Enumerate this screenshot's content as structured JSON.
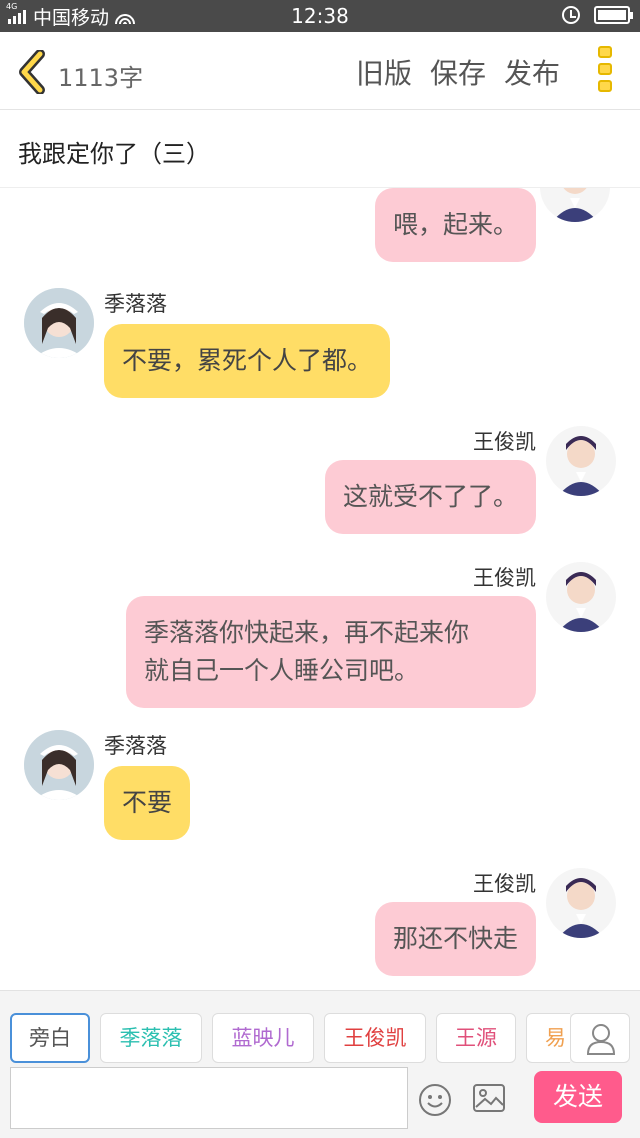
{
  "status_bar": {
    "network": "4G",
    "carrier": "中国移动",
    "time": "12:38"
  },
  "toolbar": {
    "word_count": "1113字",
    "old_version": "旧版",
    "save": "保存",
    "publish": "发布"
  },
  "story": {
    "title": "我跟定你了（三）"
  },
  "messages": [
    {
      "side": "right",
      "speaker": "",
      "text": "喂，起来。",
      "color": "#fdcbd4"
    },
    {
      "side": "left",
      "speaker": "季落落",
      "text": "不要，累死个人了都。",
      "color": "#ffdd66"
    },
    {
      "side": "right",
      "speaker": "王俊凯",
      "text": "这就受不了了。",
      "color": "#fdcbd4"
    },
    {
      "side": "right",
      "speaker": "王俊凯",
      "lines": [
        "季落落你快起来，再不起来你",
        "就自己一个人睡公司吧。"
      ],
      "color": "#fdcbd4"
    },
    {
      "side": "left",
      "speaker": "季落落",
      "text": "不要",
      "color": "#ffdd66"
    },
    {
      "side": "right",
      "speaker": "王俊凯",
      "text": "那还不快走",
      "color": "#fdcbd4"
    }
  ],
  "characters": [
    {
      "name": "旁白",
      "color": "#555555"
    },
    {
      "name": "季落落",
      "color": "#2bbfb0"
    },
    {
      "name": "蓝映儿",
      "color": "#b06ad0"
    },
    {
      "name": "王俊凯",
      "color": "#e04040"
    },
    {
      "name": "王源",
      "color": "#e0507a"
    },
    {
      "name": "易",
      "color": "#f0a050"
    }
  ],
  "composer": {
    "input_value": "",
    "send_label": "发送"
  },
  "icons": {
    "back": "chevron-left-icon",
    "more": "more-vertical-icon",
    "user": "user-icon",
    "emoji": "emoji-icon",
    "image": "image-icon"
  }
}
